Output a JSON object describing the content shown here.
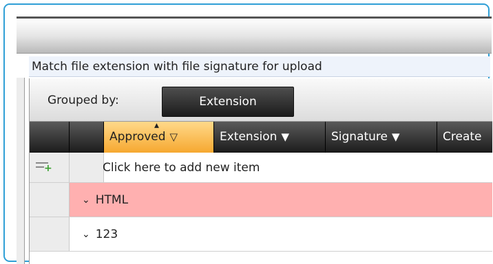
{
  "description": "Match file extension with file signature for upload",
  "group_panel": {
    "label": "Grouped by:",
    "chip": "Extension"
  },
  "columns": [
    {
      "label": "Approved",
      "icon": "filter-icon",
      "selected": true
    },
    {
      "label": "Extension",
      "icon": "filter-icon"
    },
    {
      "label": "Signature",
      "icon": "filter-icon"
    },
    {
      "label": "Create",
      "icon": "filter-icon"
    }
  ],
  "new_item_row": {
    "text": "Click here to add new item"
  },
  "groups": [
    {
      "label": "HTML",
      "highlight_color": "#ffb0b0"
    },
    {
      "label": "123",
      "highlight_color": "#ffffff"
    }
  ],
  "colors": {
    "frame_border": "#2f9fd6",
    "selected_header": "#f6a830",
    "header_dark": "#1d1d1d",
    "html_group": "#ffb0b0"
  }
}
